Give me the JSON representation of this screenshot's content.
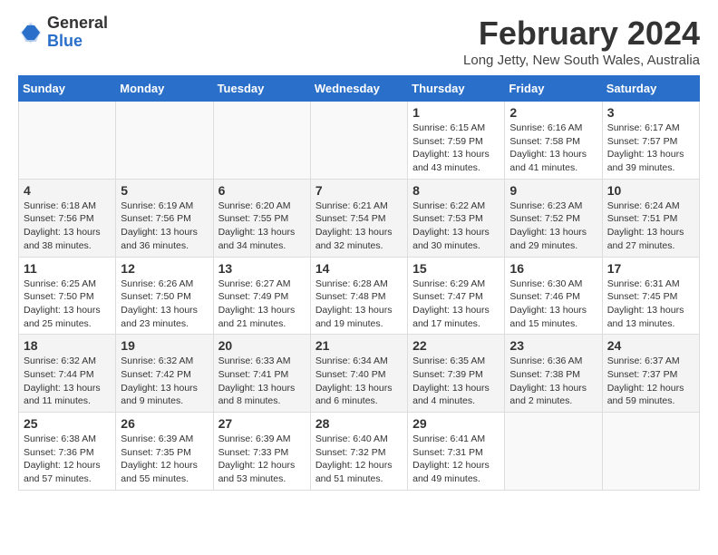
{
  "logo": {
    "text_general": "General",
    "text_blue": "Blue"
  },
  "header": {
    "month_year": "February 2024",
    "location": "Long Jetty, New South Wales, Australia"
  },
  "days_of_week": [
    "Sunday",
    "Monday",
    "Tuesday",
    "Wednesday",
    "Thursday",
    "Friday",
    "Saturday"
  ],
  "weeks": [
    {
      "cells": [
        {
          "day": "",
          "info": ""
        },
        {
          "day": "",
          "info": ""
        },
        {
          "day": "",
          "info": ""
        },
        {
          "day": "",
          "info": ""
        },
        {
          "day": "1",
          "info": "Sunrise: 6:15 AM\nSunset: 7:59 PM\nDaylight: 13 hours\nand 43 minutes."
        },
        {
          "day": "2",
          "info": "Sunrise: 6:16 AM\nSunset: 7:58 PM\nDaylight: 13 hours\nand 41 minutes."
        },
        {
          "day": "3",
          "info": "Sunrise: 6:17 AM\nSunset: 7:57 PM\nDaylight: 13 hours\nand 39 minutes."
        }
      ]
    },
    {
      "cells": [
        {
          "day": "4",
          "info": "Sunrise: 6:18 AM\nSunset: 7:56 PM\nDaylight: 13 hours\nand 38 minutes."
        },
        {
          "day": "5",
          "info": "Sunrise: 6:19 AM\nSunset: 7:56 PM\nDaylight: 13 hours\nand 36 minutes."
        },
        {
          "day": "6",
          "info": "Sunrise: 6:20 AM\nSunset: 7:55 PM\nDaylight: 13 hours\nand 34 minutes."
        },
        {
          "day": "7",
          "info": "Sunrise: 6:21 AM\nSunset: 7:54 PM\nDaylight: 13 hours\nand 32 minutes."
        },
        {
          "day": "8",
          "info": "Sunrise: 6:22 AM\nSunset: 7:53 PM\nDaylight: 13 hours\nand 30 minutes."
        },
        {
          "day": "9",
          "info": "Sunrise: 6:23 AM\nSunset: 7:52 PM\nDaylight: 13 hours\nand 29 minutes."
        },
        {
          "day": "10",
          "info": "Sunrise: 6:24 AM\nSunset: 7:51 PM\nDaylight: 13 hours\nand 27 minutes."
        }
      ]
    },
    {
      "cells": [
        {
          "day": "11",
          "info": "Sunrise: 6:25 AM\nSunset: 7:50 PM\nDaylight: 13 hours\nand 25 minutes."
        },
        {
          "day": "12",
          "info": "Sunrise: 6:26 AM\nSunset: 7:50 PM\nDaylight: 13 hours\nand 23 minutes."
        },
        {
          "day": "13",
          "info": "Sunrise: 6:27 AM\nSunset: 7:49 PM\nDaylight: 13 hours\nand 21 minutes."
        },
        {
          "day": "14",
          "info": "Sunrise: 6:28 AM\nSunset: 7:48 PM\nDaylight: 13 hours\nand 19 minutes."
        },
        {
          "day": "15",
          "info": "Sunrise: 6:29 AM\nSunset: 7:47 PM\nDaylight: 13 hours\nand 17 minutes."
        },
        {
          "day": "16",
          "info": "Sunrise: 6:30 AM\nSunset: 7:46 PM\nDaylight: 13 hours\nand 15 minutes."
        },
        {
          "day": "17",
          "info": "Sunrise: 6:31 AM\nSunset: 7:45 PM\nDaylight: 13 hours\nand 13 minutes."
        }
      ]
    },
    {
      "cells": [
        {
          "day": "18",
          "info": "Sunrise: 6:32 AM\nSunset: 7:44 PM\nDaylight: 13 hours\nand 11 minutes."
        },
        {
          "day": "19",
          "info": "Sunrise: 6:32 AM\nSunset: 7:42 PM\nDaylight: 13 hours\nand 9 minutes."
        },
        {
          "day": "20",
          "info": "Sunrise: 6:33 AM\nSunset: 7:41 PM\nDaylight: 13 hours\nand 8 minutes."
        },
        {
          "day": "21",
          "info": "Sunrise: 6:34 AM\nSunset: 7:40 PM\nDaylight: 13 hours\nand 6 minutes."
        },
        {
          "day": "22",
          "info": "Sunrise: 6:35 AM\nSunset: 7:39 PM\nDaylight: 13 hours\nand 4 minutes."
        },
        {
          "day": "23",
          "info": "Sunrise: 6:36 AM\nSunset: 7:38 PM\nDaylight: 13 hours\nand 2 minutes."
        },
        {
          "day": "24",
          "info": "Sunrise: 6:37 AM\nSunset: 7:37 PM\nDaylight: 12 hours\nand 59 minutes."
        }
      ]
    },
    {
      "cells": [
        {
          "day": "25",
          "info": "Sunrise: 6:38 AM\nSunset: 7:36 PM\nDaylight: 12 hours\nand 57 minutes."
        },
        {
          "day": "26",
          "info": "Sunrise: 6:39 AM\nSunset: 7:35 PM\nDaylight: 12 hours\nand 55 minutes."
        },
        {
          "day": "27",
          "info": "Sunrise: 6:39 AM\nSunset: 7:33 PM\nDaylight: 12 hours\nand 53 minutes."
        },
        {
          "day": "28",
          "info": "Sunrise: 6:40 AM\nSunset: 7:32 PM\nDaylight: 12 hours\nand 51 minutes."
        },
        {
          "day": "29",
          "info": "Sunrise: 6:41 AM\nSunset: 7:31 PM\nDaylight: 12 hours\nand 49 minutes."
        },
        {
          "day": "",
          "info": ""
        },
        {
          "day": "",
          "info": ""
        }
      ]
    }
  ]
}
